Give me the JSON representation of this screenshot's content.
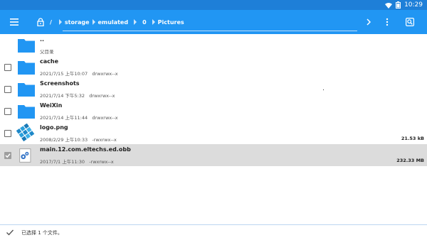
{
  "status_bar": {
    "time": "10:29"
  },
  "toolbar": {
    "root_label": "/",
    "breadcrumbs": [
      "storage",
      "emulated",
      "0",
      "Pictures"
    ]
  },
  "files": [
    {
      "name": "..",
      "meta": "父目录",
      "size": "",
      "type": "folder",
      "checkbox": false
    },
    {
      "name": "cache",
      "meta": "2021/7/15 上午10:07   drwxrwx--x",
      "size": "",
      "type": "folder",
      "checkbox": true,
      "checked": false
    },
    {
      "name": "Screenshots",
      "meta": "2021/7/14 下午5:32   drwxrwx--x",
      "size": "",
      "type": "folder",
      "checkbox": true,
      "checked": false
    },
    {
      "name": "WeiXin",
      "meta": "2021/7/14 上午11:44   drwxrwx--x",
      "size": "",
      "type": "folder",
      "checkbox": true,
      "checked": false
    },
    {
      "name": "logo.png",
      "meta": "2008/2/29 上午10:33   -rwxrwx--x",
      "size": "21.53 kB",
      "type": "image",
      "checkbox": true,
      "checked": false
    },
    {
      "name": "main.12.com.eltechs.ed.obb",
      "meta": "2017/7/1 上午11:30   -rwxrwx--x",
      "size": "232.33 MB",
      "type": "obb",
      "checkbox": true,
      "checked": true
    }
  ],
  "bottom_bar": {
    "status_text": "已选择 1 个文件。"
  },
  "colors": {
    "toolbar": "#2196f3",
    "status_bar": "#1e7fd8",
    "folder": "#2196f3",
    "selected_row": "#dcdcdc"
  }
}
